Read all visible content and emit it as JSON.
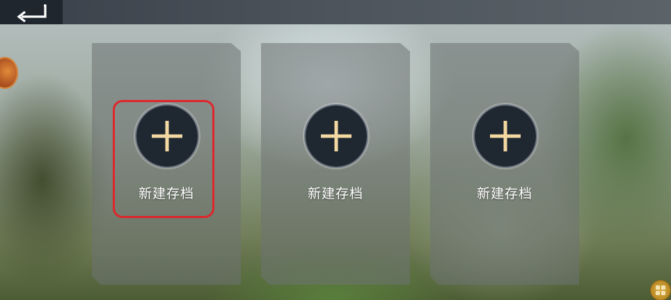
{
  "topbar": {
    "back_icon": "back-arrow-icon"
  },
  "side": {
    "badge_icon": "emblem-icon"
  },
  "slots": [
    {
      "label": "新建存档",
      "icon": "plus-icon"
    },
    {
      "label": "新建存档",
      "icon": "plus-icon"
    },
    {
      "label": "新建存档",
      "icon": "plus-icon"
    }
  ],
  "selected_slot": 1,
  "corner": {
    "badge_icon": "privacy-badge-icon"
  },
  "colors": {
    "highlight": "#e0252b",
    "plus": "#f3d8a2",
    "circle_bg": "#1f2730"
  }
}
